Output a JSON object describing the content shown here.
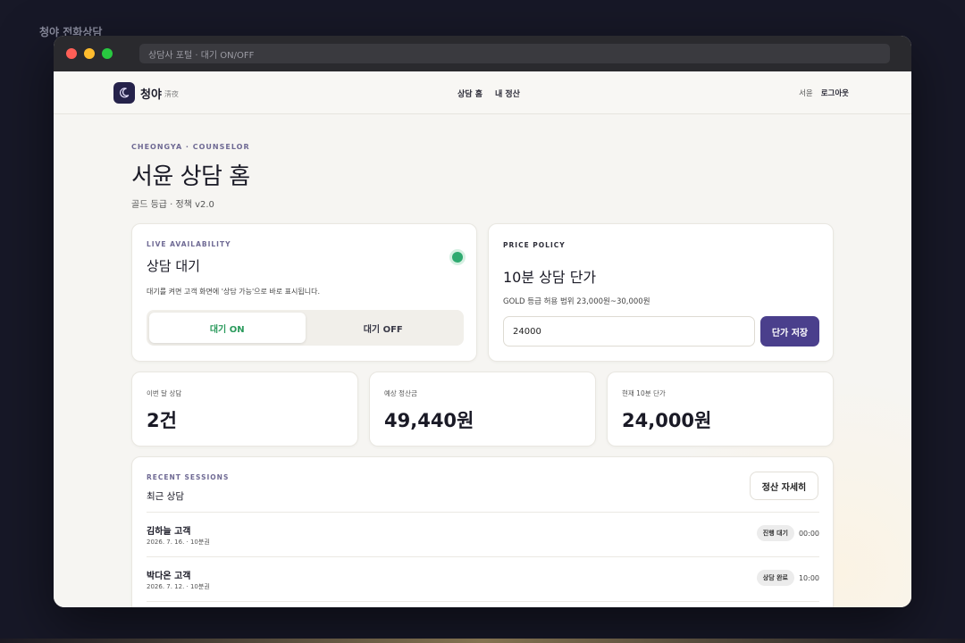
{
  "desktop": {
    "label": "청야 전화상담"
  },
  "browser": {
    "url": "상담사 포털 · 대기 ON/OFF"
  },
  "nav": {
    "brand": "청야",
    "brand_sub": "淸夜",
    "links": [
      "상담 홈",
      "내 정산"
    ],
    "user": "서윤",
    "logout": "로그아웃"
  },
  "header": {
    "eyebrow": "CHEONGYA · COUNSELOR",
    "title": "서윤 상담 홈",
    "subtitle": "골드 등급 · 정책 v2.0"
  },
  "availability": {
    "eyebrow": "LIVE AVAILABILITY",
    "title": "상담 대기",
    "description": "대기를 켜면 고객 화면에 '상담 가능'으로 바로 표시됩니다.",
    "on_label": "대기 ON",
    "off_label": "대기 OFF",
    "status_color": "#2faa70"
  },
  "price": {
    "eyebrow": "PRICE POLICY",
    "title": "10분 상담 단가",
    "range": "GOLD 등급 허용 범위 23,000원~30,000원",
    "input_value": "24000",
    "save_label": "단가 저장"
  },
  "stats": [
    {
      "label": "이번 달 상담",
      "value": "2건"
    },
    {
      "label": "예상 정산금",
      "value": "49,440원"
    },
    {
      "label": "현재 10분 단가",
      "value": "24,000원"
    }
  ],
  "sessions": {
    "eyebrow": "RECENT SESSIONS",
    "title": "최근 상담",
    "detail_label": "정산 자세히",
    "rows": [
      {
        "name": "김하늘 고객",
        "meta": "2026. 7. 16. · 10분권",
        "badge": "진행 대기",
        "time": "00:00"
      },
      {
        "name": "박다온 고객",
        "meta": "2026. 7. 12. · 10분권",
        "badge": "상담 완료",
        "time": "10:00"
      }
    ]
  },
  "colors": {
    "accent": "#4a3f8c",
    "on_text": "#2a9a5c",
    "desktop_bg": "#171827"
  }
}
